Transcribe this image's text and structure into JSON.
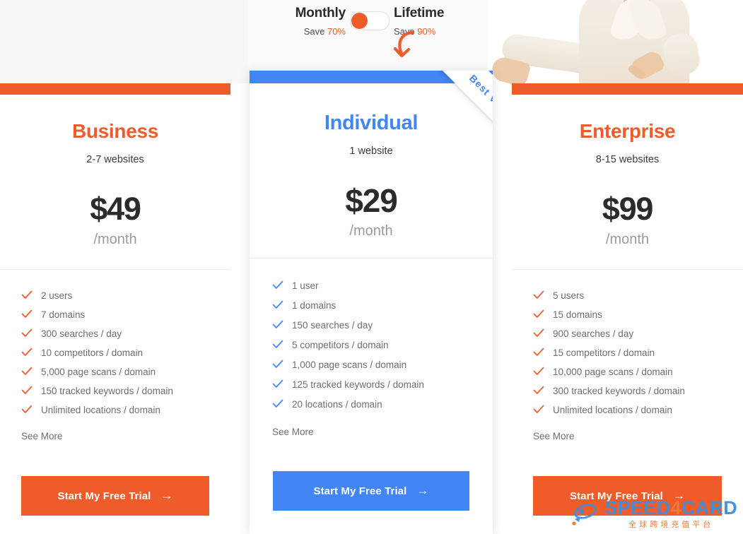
{
  "billing_toggle": {
    "monthly": {
      "label": "Monthly",
      "save_prefix": "Save ",
      "save_value": "70%"
    },
    "lifetime": {
      "label": "Lifetime",
      "save_prefix": "Save ",
      "save_value": "90%"
    },
    "selected": "Monthly",
    "arrow_icon": "curved-down-arrow-icon"
  },
  "colors": {
    "orange": "#ef5b29",
    "blue": "#4285f4",
    "price_text": "#2b2b2b",
    "feature_text": "#6e6e6e",
    "page_bg": "#f7f7f7"
  },
  "plans": [
    {
      "id": "business",
      "name": "Business",
      "websites": "2-7 websites",
      "price": "$49",
      "period": "/month",
      "features": [
        "2 users",
        "7 domains",
        "300 searches / day",
        "10 competitors / domain",
        "5,000 page scans / domain",
        "150 tracked keywords / domain",
        "Unlimited locations / domain"
      ],
      "see_more": "See More",
      "cta": "Start My Free Trial",
      "cta_arrow": "→"
    },
    {
      "id": "individual",
      "name": "Individual",
      "websites": "1 website",
      "price": "$29",
      "period": "/month",
      "ribbon": "Best Value",
      "features": [
        "1 user",
        "1 domains",
        "150 searches / day",
        "5 competitors / domain",
        "1,000 page scans / domain",
        "125 tracked keywords / domain",
        "20 locations / domain"
      ],
      "see_more": "See More",
      "cta": "Start My Free Trial",
      "cta_arrow": "→"
    },
    {
      "id": "enterprise",
      "name": "Enterprise",
      "websites": "8-15 websites",
      "price": "$99",
      "period": "/month",
      "features": [
        "5 users",
        "15 domains",
        "900 searches / day",
        "15 competitors / domain",
        "10,000 page scans / domain",
        "300 tracked keywords / domain",
        "Unlimited locations / domain"
      ],
      "see_more": "See More",
      "cta": "Start My Free Trial",
      "cta_arrow": "→"
    }
  ],
  "watermark": {
    "brand_part1": "SPEED",
    "brand_highlight": "4",
    "brand_part2": "CARD",
    "subtitle": "全球跨境充值平台",
    "icon": "rocket-icon"
  }
}
